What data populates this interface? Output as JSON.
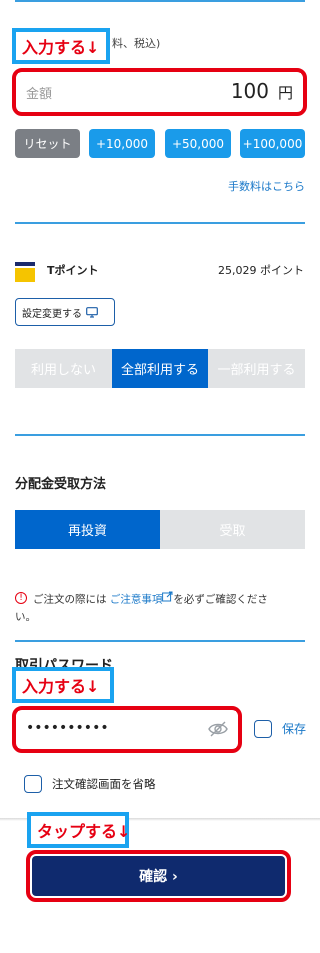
{
  "callouts": {
    "input1": "入力する↓",
    "input2": "入力する↓",
    "tap": "タップする↓"
  },
  "amount": {
    "hidden_note": "料、税込)",
    "placeholder": "金額",
    "value": "100",
    "unit": "円",
    "reset_label": "リセット",
    "quick_buttons": [
      "+10,000",
      "+50,000",
      "+100,000"
    ],
    "fee_link": "手数料はこちら"
  },
  "tpoint": {
    "logo_letter": "T",
    "label": "Tポイント",
    "balance": "25,029 ポイント",
    "settings_label": "設定変更する",
    "options": [
      "利用しない",
      "全部利用する",
      "一部利用する"
    ],
    "selected": "全部利用する"
  },
  "distribution": {
    "title": "分配金受取方法",
    "options": [
      "再投資",
      "受取"
    ],
    "selected": "再投資"
  },
  "notice": {
    "prefix": "ご注文の際には",
    "link": "ご注意事項",
    "suffix": "を必ずご確認くださ",
    "suffix2": "い。"
  },
  "password": {
    "title": "取引パスワード",
    "value": "••••••••••",
    "save_label": "保存"
  },
  "skip_confirm_label": "注文確認画面を省略",
  "confirm_label": "確認 ›",
  "colors": {
    "accent": "#1a9bea",
    "primary": "#0066cc",
    "navy": "#0f2a6e",
    "highlight_red": "#e60012"
  }
}
